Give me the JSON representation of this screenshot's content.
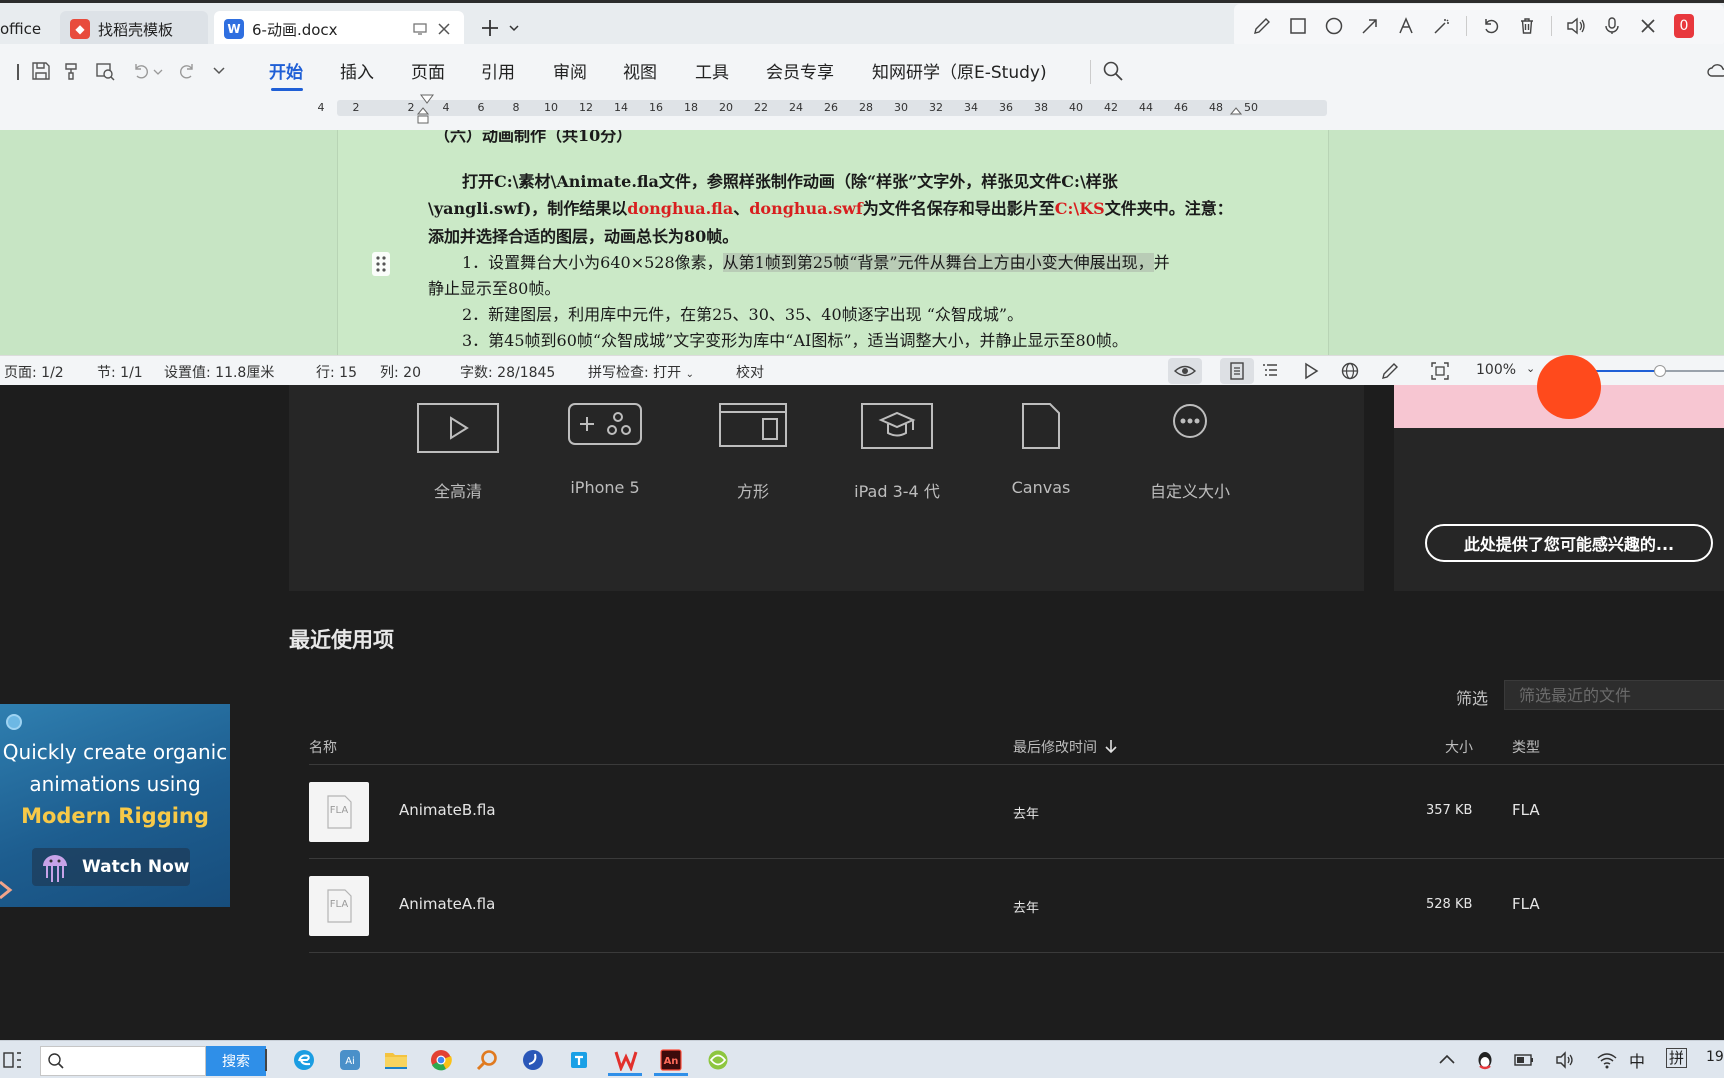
{
  "tabs": {
    "office": "office",
    "template": "找稻壳模板",
    "doc": "6-动画.docx"
  },
  "ribbon": {
    "menu": [
      "开始",
      "插入",
      "页面",
      "引用",
      "审阅",
      "视图",
      "工具",
      "会员专享",
      "知网研学（原E-Study)"
    ]
  },
  "ruler": {
    "ticks": [
      "4",
      "2",
      "2",
      "4",
      "6",
      "8",
      "10",
      "12",
      "14",
      "16",
      "18",
      "20",
      "22",
      "24",
      "26",
      "28",
      "30",
      "32",
      "34",
      "36",
      "38",
      "40",
      "42",
      "44",
      "46",
      "48",
      "50"
    ]
  },
  "doc": {
    "heading": "（六）动画制作（共10分）",
    "p1_a": "打开C:\\素材\\Animate.fla文件，参照样张制作动画（除“样张”文字外，样张见文件C:\\样张",
    "p2_a": "\\yangli.swf)，制作结果以",
    "p2_red1": "donghua.fla",
    "p2_sep": "、",
    "p2_red2": "donghua.swf",
    "p2_b": "为文件名保存和导出影片至",
    "p2_red3": "C:\\KS",
    "p2_c": "文件夹中。注意：",
    "p3": "添加并选择合适的图层，动画总长为80帧。",
    "item1_a": "1．设置舞台大小为640×528像素，",
    "item1_hl": "从第1帧到第25帧“背景”元件从舞台上方由小变大伸展出现，",
    "item1_b": "并",
    "item1_c": "静止显示至80帧。",
    "item2": "2．新建图层，利用库中元件，在第25、30、35、40帧逐字出现 “众智成城”。",
    "item3": "3．第45帧到60帧“众智成城”文字变形为库中“AI图标”，适当调整大小，并静止显示至80帧。"
  },
  "status": {
    "page": "页面: 1/2",
    "section": "节: 1/1",
    "setting": "设置值: 11.8厘米",
    "row": "行: 15",
    "col": "列: 20",
    "words": "字数: 28/1845",
    "spell": "拼写检查: 打开",
    "proof": "校对",
    "zoom": "100%"
  },
  "presets": [
    "全高清",
    "iPhone 5",
    "方形",
    "iPad 3-4 代",
    "Canvas",
    "自定义大小"
  ],
  "promo": {
    "pill": "此处提供了您可能感兴趣的..."
  },
  "recent": {
    "title": "最近使用项",
    "filter_label": "筛选",
    "filter_placeholder": "筛选最近的文件",
    "columns": {
      "name": "名称",
      "modified": "最后修改时间",
      "size": "大小",
      "type": "类型"
    },
    "files": [
      {
        "name": "AnimateB.fla",
        "modified": "去年",
        "size": "357 KB",
        "type": "FLA",
        "thumb": "FLA"
      },
      {
        "name": "AnimateA.fla",
        "modified": "去年",
        "size": "528 KB",
        "type": "FLA",
        "thumb": "FLA"
      }
    ]
  },
  "ad": {
    "line1": "Quickly create organic",
    "line2": "animations using",
    "line3": "Modern Rigging",
    "button": "Watch Now"
  },
  "taskbar": {
    "search_btn": "搜索",
    "ime1": "中",
    "ime2": "拼",
    "clock": "19"
  },
  "anno_badge": "0",
  "colors": {
    "accent": "#1f5fd6",
    "doc_bg": "#c7e5c4",
    "highlight_red": "#d81f1f",
    "animate_bg": "#1d1d1d",
    "ad_gold": "#f7c948"
  }
}
